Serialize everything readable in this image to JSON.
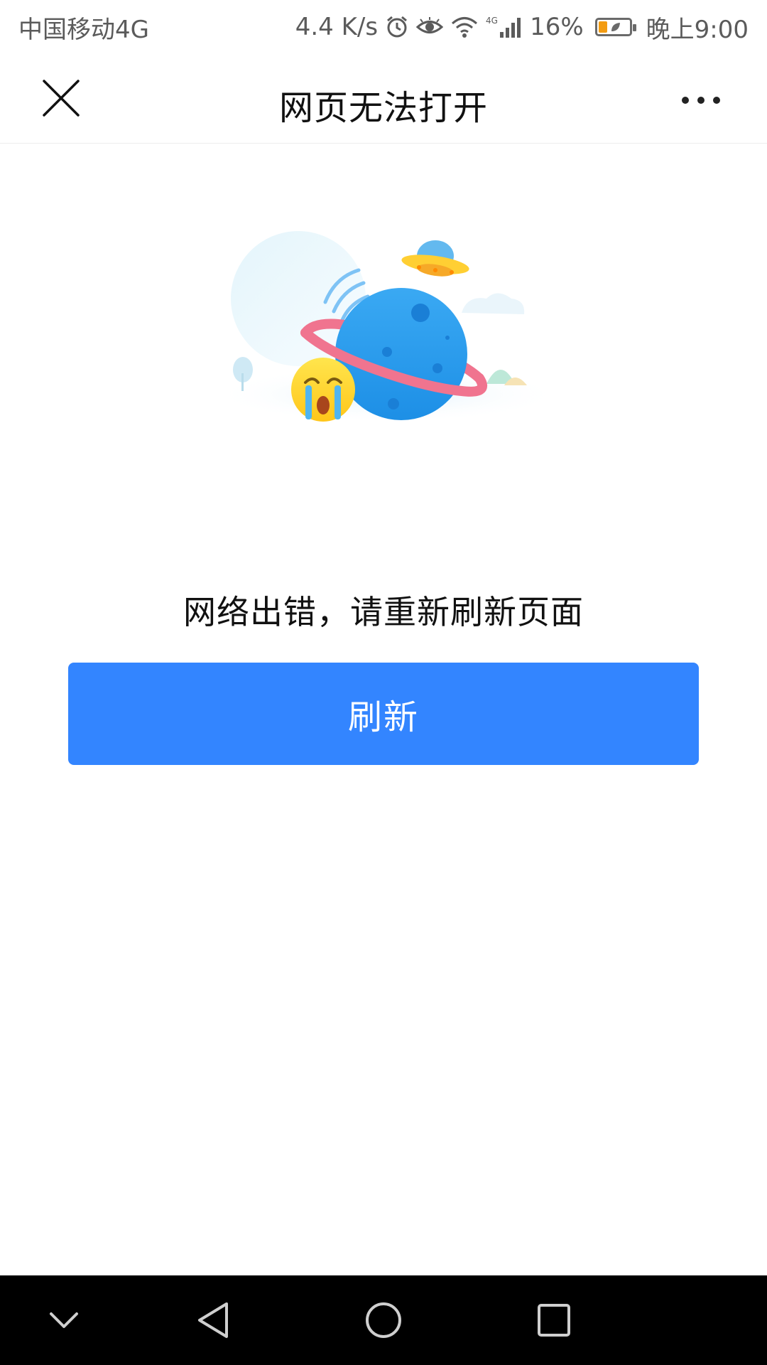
{
  "status_bar": {
    "carrier": "中国移动4G",
    "net_speed": "4.4 K/s",
    "battery_percent": "16%",
    "battery_level": 0.16,
    "time": "晚上9:00",
    "icons": [
      "alarm-icon",
      "eye-icon",
      "wifi-icon",
      "signal-icon",
      "battery-icon"
    ]
  },
  "title_bar": {
    "title": "网页无法打开",
    "left_icon": "close-icon",
    "right_icon": "more-icon"
  },
  "main": {
    "illustration": "error-planet-illustration",
    "message": "网络出错，请重新刷新页面",
    "refresh_label": "刷新",
    "accent_color": "#3385ff"
  },
  "nav_bar": {
    "icons": [
      "hide-keyboard-icon",
      "back-icon",
      "home-icon",
      "recents-icon"
    ]
  }
}
